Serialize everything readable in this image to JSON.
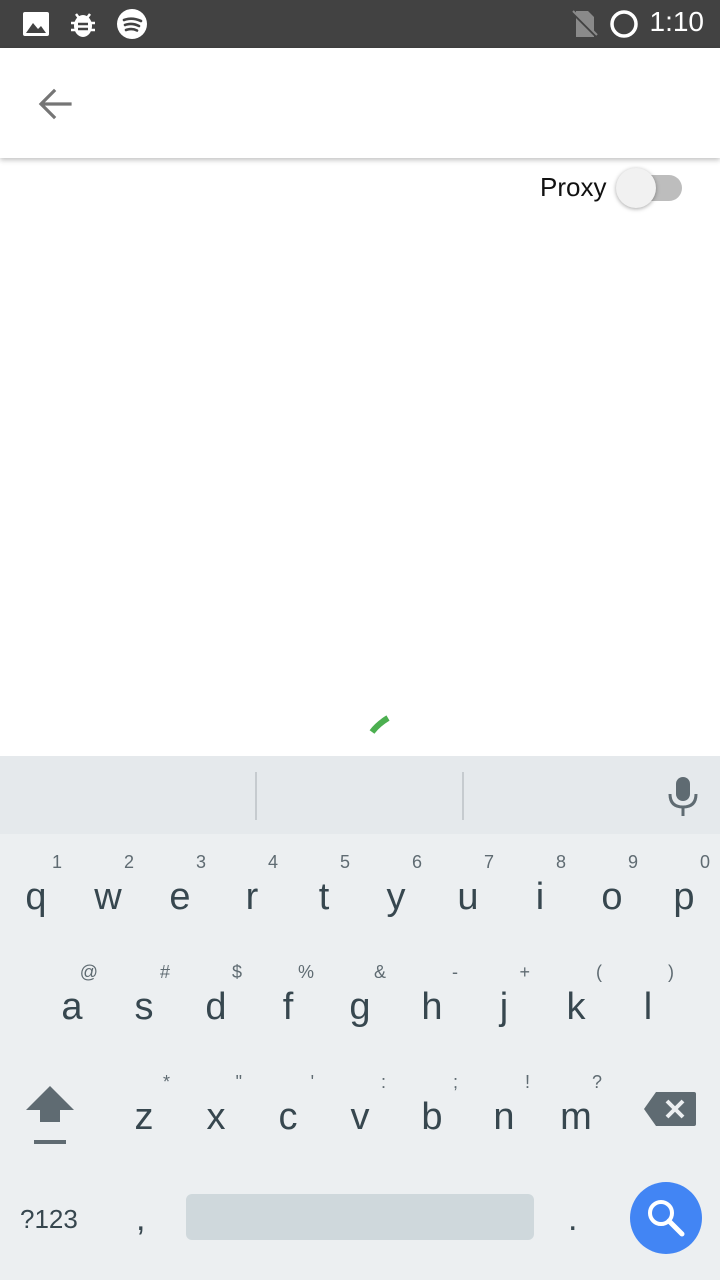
{
  "status_bar": {
    "time": "1:10",
    "left_icons": [
      "image-icon",
      "bug-icon",
      "spotify-icon"
    ],
    "right_icons": [
      "no-sim-icon",
      "sync-circle-icon"
    ]
  },
  "app_bar": {
    "back_icon": "arrow-back-icon"
  },
  "proxy": {
    "label": "Proxy",
    "enabled": false
  },
  "loading": {
    "color": "#4caf50"
  },
  "keyboard": {
    "row1": [
      {
        "key": "q",
        "hint": "1"
      },
      {
        "key": "w",
        "hint": "2"
      },
      {
        "key": "e",
        "hint": "3"
      },
      {
        "key": "r",
        "hint": "4"
      },
      {
        "key": "t",
        "hint": "5"
      },
      {
        "key": "y",
        "hint": "6"
      },
      {
        "key": "u",
        "hint": "7"
      },
      {
        "key": "i",
        "hint": "8"
      },
      {
        "key": "o",
        "hint": "9"
      },
      {
        "key": "p",
        "hint": "0"
      }
    ],
    "row2": [
      {
        "key": "a",
        "hint": "@"
      },
      {
        "key": "s",
        "hint": "#"
      },
      {
        "key": "d",
        "hint": "$"
      },
      {
        "key": "f",
        "hint": "%"
      },
      {
        "key": "g",
        "hint": "&"
      },
      {
        "key": "h",
        "hint": "-"
      },
      {
        "key": "j",
        "hint": "+"
      },
      {
        "key": "k",
        "hint": "("
      },
      {
        "key": "l",
        "hint": ")"
      }
    ],
    "row3": [
      {
        "key": "z",
        "hint": "*"
      },
      {
        "key": "x",
        "hint": "\""
      },
      {
        "key": "c",
        "hint": "'"
      },
      {
        "key": "v",
        "hint": ":"
      },
      {
        "key": "b",
        "hint": ";"
      },
      {
        "key": "n",
        "hint": "!"
      },
      {
        "key": "m",
        "hint": "?"
      }
    ],
    "symbols_label": "?123",
    "comma": ",",
    "period": ".",
    "accent_color": "#4285f4"
  }
}
